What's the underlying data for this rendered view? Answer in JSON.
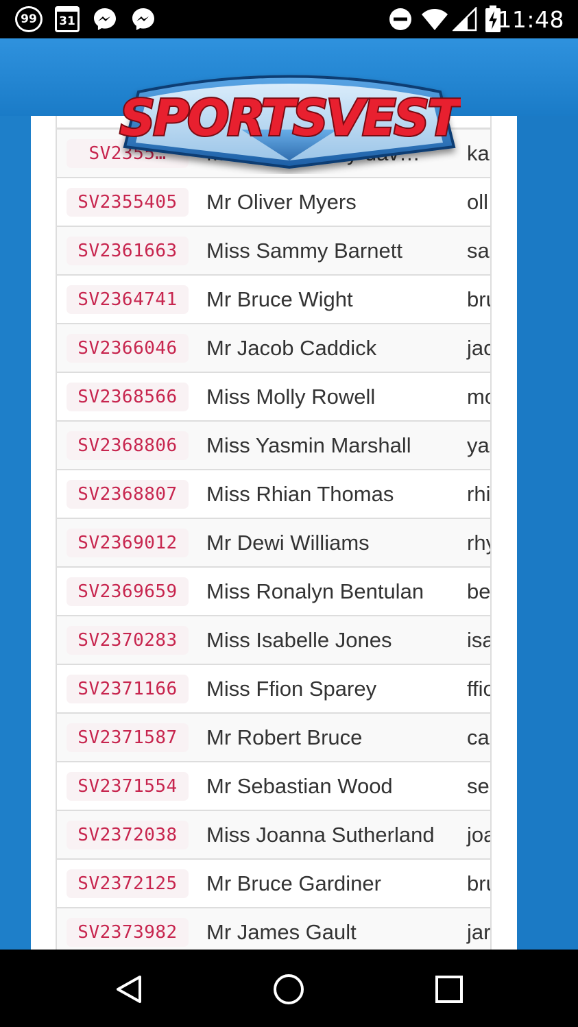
{
  "status_bar": {
    "badge_count": "99",
    "calendar_day": "31",
    "time": "11:48",
    "icons": [
      "badge-99-icon",
      "calendar-icon",
      "messenger-icon",
      "messenger-icon",
      "do-not-disturb-icon",
      "wifi-icon",
      "signal-icon",
      "battery-charging-icon"
    ]
  },
  "header": {
    "logo_text": "SPORTSVEST"
  },
  "table": {
    "partial_first_row": {
      "code": "SV2355…",
      "name": "Miss Kira Ashby-dav…",
      "email": "ka"
    },
    "rows": [
      {
        "code": "SV2355405",
        "name": "Mr Oliver Myers",
        "email": "oll"
      },
      {
        "code": "SV2361663",
        "name": "Miss Sammy Barnett",
        "email": "sa"
      },
      {
        "code": "SV2364741",
        "name": "Mr Bruce Wight",
        "email": "bru"
      },
      {
        "code": "SV2366046",
        "name": "Mr Jacob Caddick",
        "email": "jac"
      },
      {
        "code": "SV2368566",
        "name": "Miss Molly Rowell",
        "email": "mo"
      },
      {
        "code": "SV2368806",
        "name": "Miss Yasmin Marshall",
        "email": "yas"
      },
      {
        "code": "SV2368807",
        "name": "Miss Rhian Thomas",
        "email": "rhi"
      },
      {
        "code": "SV2369012",
        "name": "Mr Dewi Williams",
        "email": "rhy"
      },
      {
        "code": "SV2369659",
        "name": "Miss Ronalyn Bentulan",
        "email": "be"
      },
      {
        "code": "SV2370283",
        "name": "Miss Isabelle Jones",
        "email": "isa"
      },
      {
        "code": "SV2371166",
        "name": "Miss Ffion Sparey",
        "email": "ffio"
      },
      {
        "code": "SV2371587",
        "name": "Mr Robert Bruce",
        "email": "ca"
      },
      {
        "code": "SV2371554",
        "name": "Mr Sebastian Wood",
        "email": "se"
      },
      {
        "code": "SV2372038",
        "name": "Miss Joanna Sutherland",
        "email": "joa"
      },
      {
        "code": "SV2372125",
        "name": "Mr Bruce Gardiner",
        "email": "bru"
      },
      {
        "code": "SV2373982",
        "name": "Mr James Gault",
        "email": "jar"
      }
    ]
  },
  "nav_bar": {
    "buttons": [
      "back-icon",
      "home-icon",
      "recents-icon"
    ]
  },
  "colors": {
    "header_blue": "#2f92de",
    "side_blue": "#1e7fc9",
    "code_text": "#c7254e",
    "code_bg": "#f9f2f4",
    "logo_red": "#e8202f"
  }
}
